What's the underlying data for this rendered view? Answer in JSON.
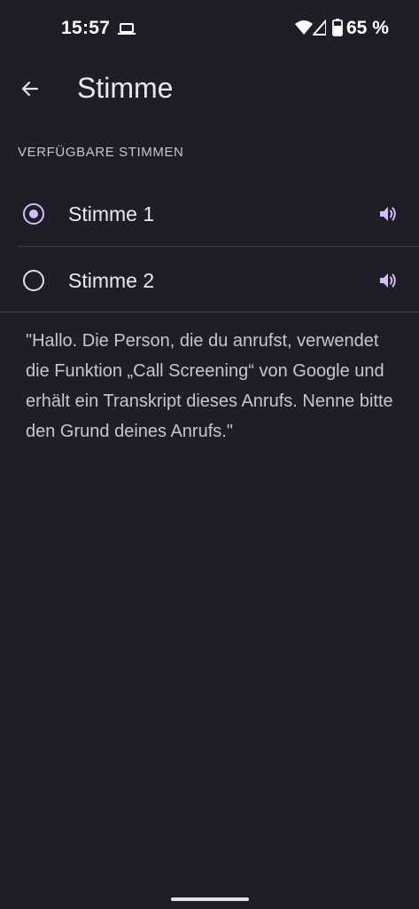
{
  "status_bar": {
    "time": "15:57",
    "battery_text": "65 %",
    "icons": [
      "laptop-icon",
      "wifi-icon",
      "signal-icon",
      "battery-icon"
    ]
  },
  "top_bar": {
    "title": "Stimme",
    "back_icon": "arrow-back-icon"
  },
  "section": {
    "header": "VERFÜGBARE STIMMEN"
  },
  "voices": [
    {
      "label": "Stimme 1",
      "selected": true,
      "icon": "speaker-icon"
    },
    {
      "label": "Stimme 2",
      "selected": false,
      "icon": "speaker-icon"
    }
  ],
  "description": "\"Hallo. Die Person, die du anrufst, verwendet die Funktion „Call Screening“ von Google und erhält ein Transkript dieses Anrufs. Nenne bitte den Grund deines Anrufs.\"",
  "colors": {
    "background": "#1f1e26",
    "accent": "#d3bcfd",
    "text_primary": "#ece6f0",
    "text_secondary": "#c9c4cf",
    "divider": "#3e3c44"
  }
}
